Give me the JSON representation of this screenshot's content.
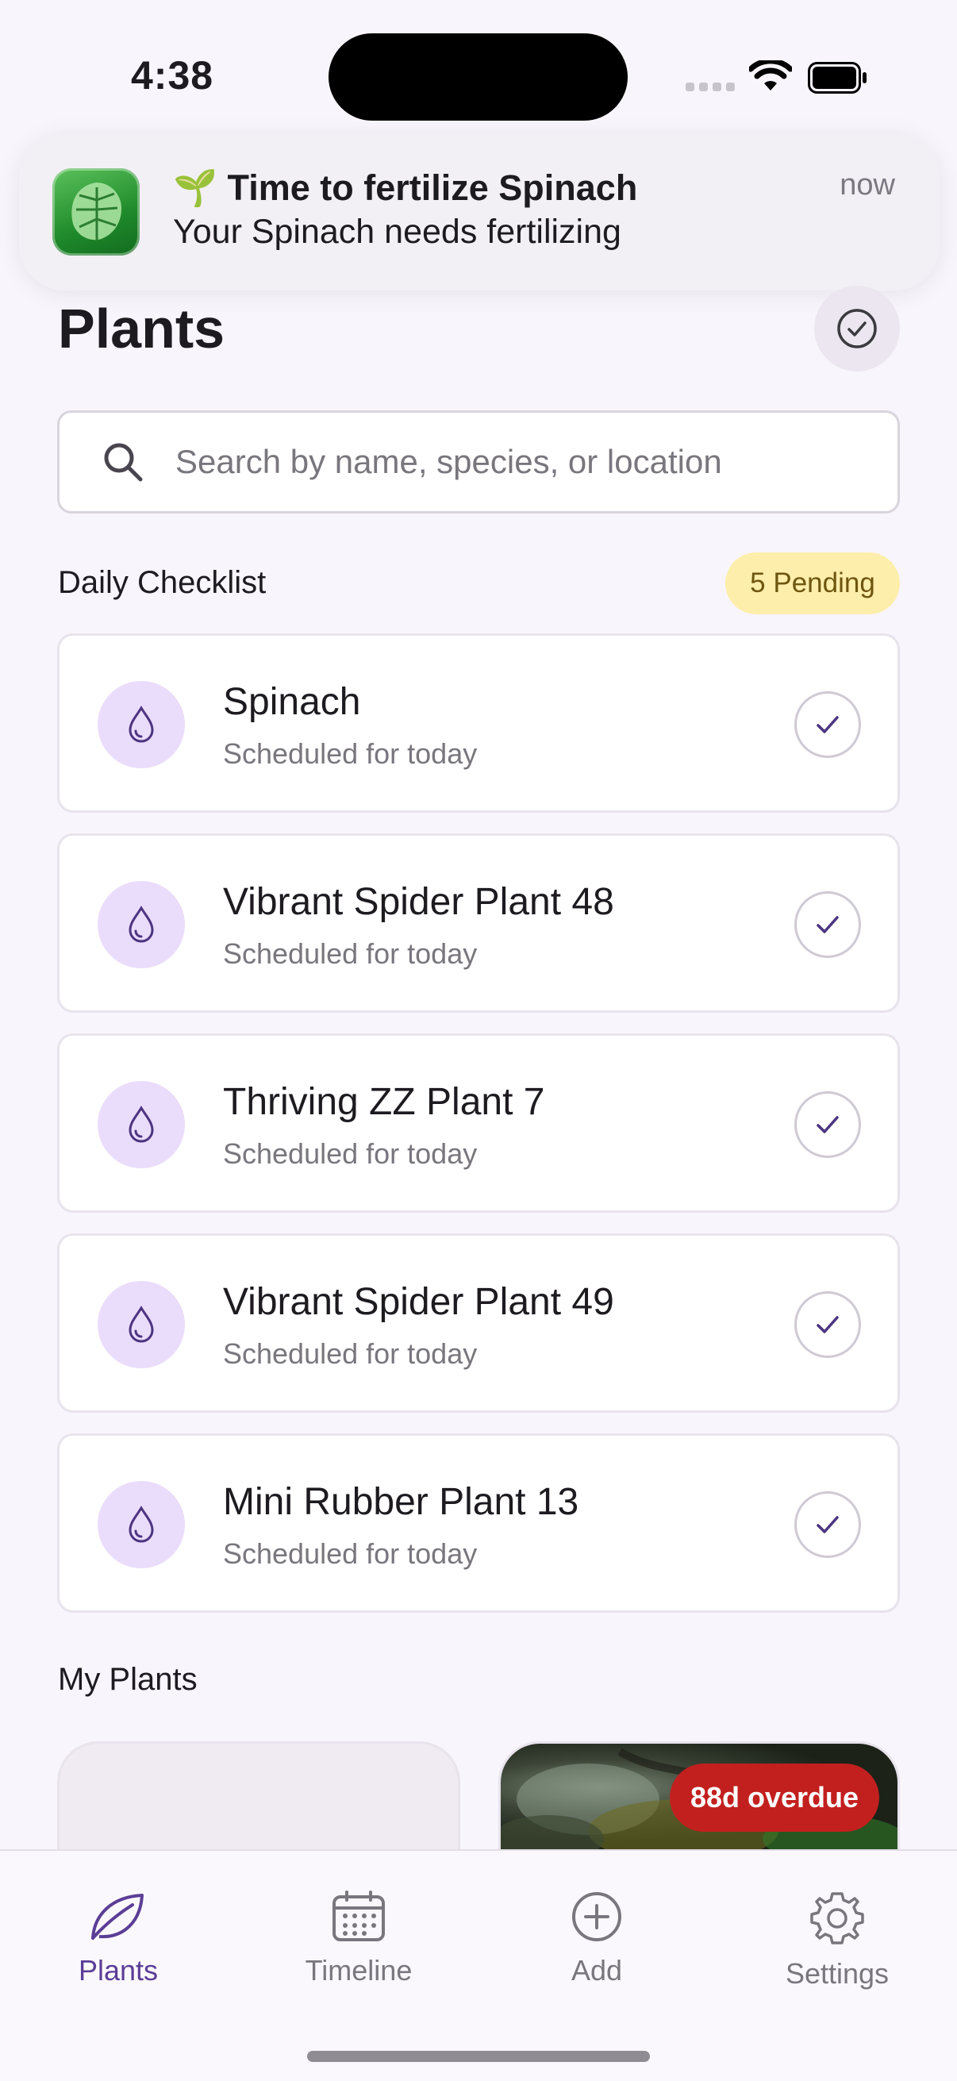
{
  "status_bar": {
    "time": "4:38"
  },
  "notification": {
    "title": "🌱 Time to fertilize Spinach",
    "body": "Your Spinach needs fertilizing",
    "time": "now",
    "app_icon": "monstera-leaf-icon"
  },
  "header": {
    "title": "Plants",
    "action_icon": "check-circle-icon"
  },
  "search": {
    "placeholder": "Search by name, species, or location",
    "value": ""
  },
  "checklist": {
    "title": "Daily Checklist",
    "badge": "5 Pending",
    "items": [
      {
        "name": "Spinach",
        "subtitle": "Scheduled for today",
        "icon": "water-drop-icon"
      },
      {
        "name": "Vibrant Spider Plant 48",
        "subtitle": "Scheduled for today",
        "icon": "water-drop-icon"
      },
      {
        "name": "Thriving ZZ Plant 7",
        "subtitle": "Scheduled for today",
        "icon": "water-drop-icon"
      },
      {
        "name": "Vibrant Spider Plant 49",
        "subtitle": "Scheduled for today",
        "icon": "water-drop-icon"
      },
      {
        "name": "Mini Rubber Plant 13",
        "subtitle": "Scheduled for today",
        "icon": "water-drop-icon"
      }
    ]
  },
  "my_plants": {
    "title": "My Plants",
    "overdue_badge": "88d overdue"
  },
  "tabs": [
    {
      "label": "Plants",
      "icon": "leaf-icon",
      "active": true
    },
    {
      "label": "Timeline",
      "icon": "calendar-icon",
      "active": false
    },
    {
      "label": "Add",
      "icon": "plus-circle-icon",
      "active": false
    },
    {
      "label": "Settings",
      "icon": "gear-icon",
      "active": false
    }
  ],
  "colors": {
    "accent": "#5b3e96",
    "overdue": "#c2201e",
    "pending_bg": "#fdeeab",
    "icon_bg": "#eadcfb"
  }
}
